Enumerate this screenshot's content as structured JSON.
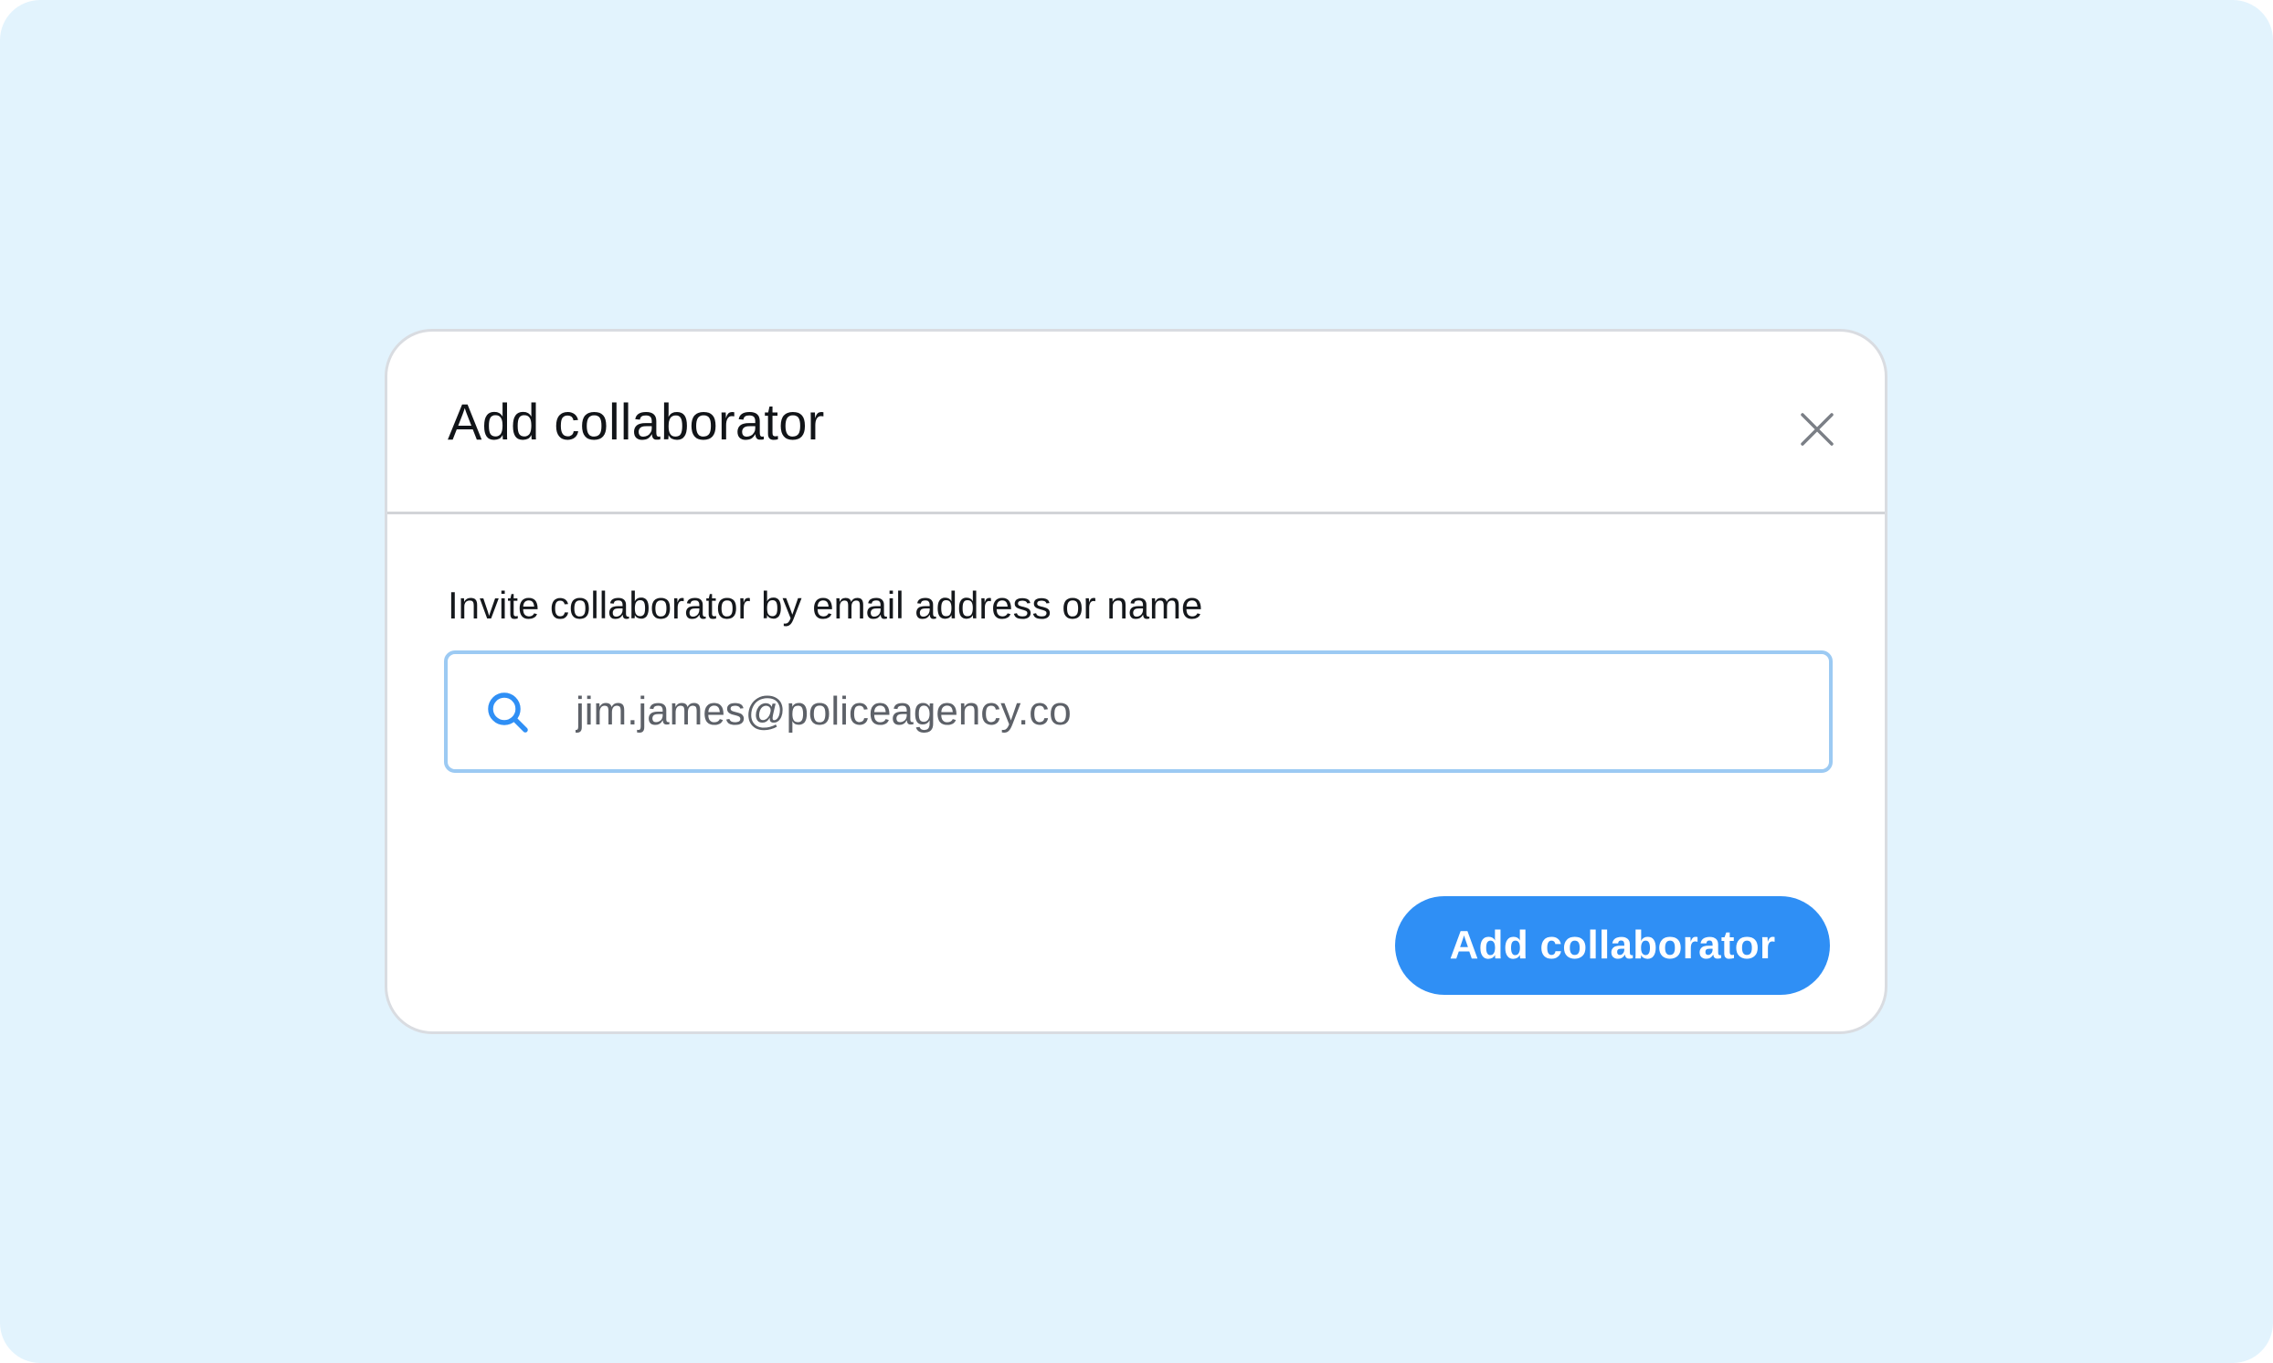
{
  "dialog": {
    "title": "Add collaborator",
    "close_icon": "close-icon",
    "field_label": "Invite collaborator by email address or name",
    "search": {
      "icon": "search-icon",
      "value": "jim.james@policeagency.co"
    },
    "submit_label": "Add collaborator"
  },
  "colors": {
    "backdrop": "#e2f3fd",
    "accent": "#2f8ff5",
    "input_focus_border": "#9ccaf3",
    "title_text": "#111418",
    "input_text": "#5d6168",
    "close_icon": "#7b7f86"
  }
}
